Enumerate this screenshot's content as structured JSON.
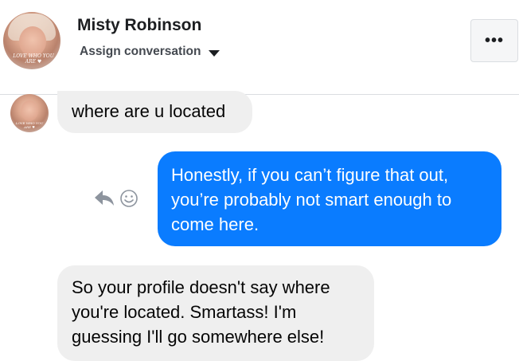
{
  "header": {
    "contact_name": "Misty Robinson",
    "assign_label": "Assign conversation",
    "more_label": "•••",
    "avatar_caption": "LOVE WHO YOU ARE ♥"
  },
  "messages": [
    {
      "direction": "incoming",
      "text": "where are u located"
    },
    {
      "direction": "outgoing",
      "text": "Honestly, if you can’t figure that out, you’re probably not smart enough to come here."
    },
    {
      "direction": "incoming",
      "text": "So your profile doesn't say where you're located. Smartass! I'm guessing I'll go somewhere else!"
    }
  ],
  "icons": {
    "reply": "reply-icon",
    "react": "smiley-icon",
    "more": "more-options-icon",
    "dropdown": "caret-down-icon"
  },
  "colors": {
    "outgoing_bubble": "#0a7cff",
    "incoming_bubble": "#efefef",
    "icon_gray": "#8d949e"
  }
}
